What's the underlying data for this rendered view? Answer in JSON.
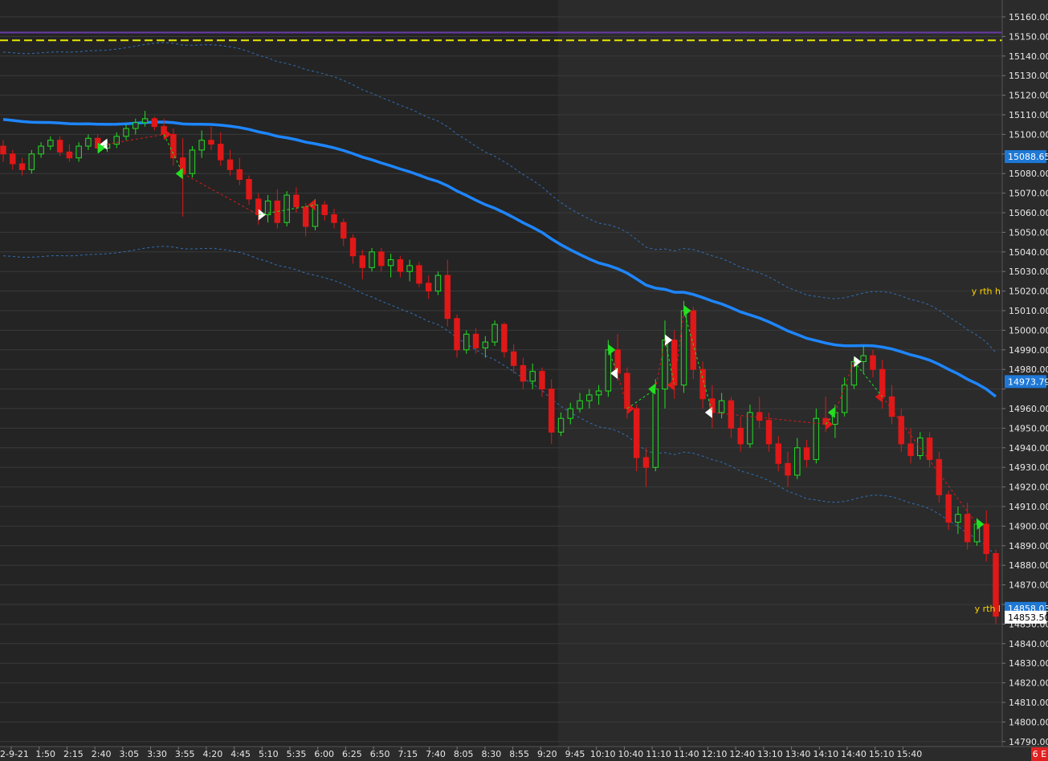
{
  "chart_data": {
    "type": "candlestick",
    "instrument_hint": "",
    "y_axis": {
      "ticks": [
        15160,
        15150,
        15140,
        15130,
        15120,
        15110,
        15100,
        15090,
        15080,
        15070,
        15060,
        15050,
        15040,
        15030,
        15020,
        15010,
        15000,
        14990,
        14980,
        14970,
        14960,
        14950,
        14940,
        14930,
        14920,
        14910,
        14900,
        14890,
        14880,
        14870,
        14860,
        14850,
        14840,
        14830,
        14820,
        14810,
        14800,
        14790
      ],
      "tick_labels": [
        "15160.00",
        "15150.00",
        "15140.00",
        "15130.00",
        "15120.00",
        "15110.00",
        "15100.00",
        "",
        "15080.00",
        "15070.00",
        "15060.00",
        "15050.00",
        "15040.00",
        "15030.00",
        "15020.00",
        "15010.00",
        "15000.00",
        "14990.00",
        "14980.00",
        "",
        "14960.00",
        "14950.00",
        "14940.00",
        "14930.00",
        "14920.00",
        "14910.00",
        "14900.00",
        "14890.00",
        "14880.00",
        "14870.00",
        "",
        "14850.00",
        "14840.00",
        "14830.00",
        "14820.00",
        "14810.00",
        "14800.00",
        "14790.00"
      ],
      "range": [
        14786,
        15165
      ],
      "side": "right"
    },
    "x_axis": {
      "tick_labels": [
        "2-9-21",
        "1:50",
        "2:15",
        "2:40",
        "3:05",
        "3:30",
        "3:55",
        "4:20",
        "4:45",
        "5:10",
        "5:35",
        "6:00",
        "6:25",
        "6:50",
        "7:15",
        "7:40",
        "8:05",
        "8:30",
        "8:55",
        "9:20",
        "9:45",
        "10:10",
        "10:40",
        "11:10",
        "11:40",
        "12:10",
        "12:40",
        "13:10",
        "13:40",
        "14:10",
        "14:40",
        "15:10",
        "15:40"
      ]
    },
    "price_tags": [
      {
        "label": "15088.65",
        "value": 15088.65,
        "color": "#1e78d6"
      },
      {
        "label": "14973.79",
        "value": 14973.79,
        "color": "#1e78d6"
      },
      {
        "label": "14858.03",
        "value": 14858.03,
        "color": "#1e78d6"
      },
      {
        "label": "14853.50",
        "value": 14853.5,
        "color": "#ffffff"
      }
    ],
    "level_labels": [
      {
        "label": "y rth h",
        "value": 15020
      },
      {
        "label": "y rth l",
        "value": 14858
      }
    ],
    "horizontal_levels": [
      {
        "value": 15152,
        "color": "#6a3aa8",
        "style": "solid"
      },
      {
        "value": 15148,
        "color": "#e6e600",
        "style": "dashed"
      }
    ],
    "corner_badge": {
      "label": "6 E",
      "color": "#e02020"
    },
    "candles_ohlc": [
      [
        15094,
        15097,
        15086,
        15090
      ],
      [
        15090,
        15092,
        15082,
        15085
      ],
      [
        15085,
        15088,
        15079,
        15082
      ],
      [
        15082,
        15092,
        15080,
        15090
      ],
      [
        15090,
        15096,
        15088,
        15094
      ],
      [
        15094,
        15099,
        15092,
        15097
      ],
      [
        15097,
        15099,
        15089,
        15091
      ],
      [
        15091,
        15095,
        15086,
        15088
      ],
      [
        15088,
        15096,
        15086,
        15094
      ],
      [
        15094,
        15100,
        15092,
        15098
      ],
      [
        15098,
        15100,
        15091,
        15093
      ],
      [
        15093,
        15097,
        15091,
        15095
      ],
      [
        15095,
        15101,
        15093,
        15099
      ],
      [
        15099,
        15105,
        15097,
        15103
      ],
      [
        15103,
        15108,
        15100,
        15106
      ],
      [
        15106,
        15112,
        15104,
        15108
      ],
      [
        15108,
        15109,
        15102,
        15104
      ],
      [
        15104,
        15108,
        15098,
        15100
      ],
      [
        15100,
        15103,
        15084,
        15088
      ],
      [
        15088,
        15098,
        15058,
        15080
      ],
      [
        15080,
        15094,
        15078,
        15092
      ],
      [
        15092,
        15102,
        15088,
        15097
      ],
      [
        15097,
        15104,
        15092,
        15095
      ],
      [
        15095,
        15101,
        15084,
        15087
      ],
      [
        15087,
        15092,
        15079,
        15082
      ],
      [
        15082,
        15088,
        15074,
        15077
      ],
      [
        15077,
        15079,
        15064,
        15067
      ],
      [
        15067,
        15070,
        15054,
        15059
      ],
      [
        15059,
        15069,
        15055,
        15066
      ],
      [
        15066,
        15072,
        15052,
        15055
      ],
      [
        15055,
        15071,
        15053,
        15069
      ],
      [
        15069,
        15073,
        15060,
        15063
      ],
      [
        15063,
        15065,
        15048,
        15053
      ],
      [
        15053,
        15067,
        15051,
        15064
      ],
      [
        15064,
        15066,
        15056,
        15059
      ],
      [
        15059,
        15062,
        15052,
        15055
      ],
      [
        15055,
        15057,
        15043,
        15047
      ],
      [
        15047,
        15049,
        15034,
        15038
      ],
      [
        15038,
        15041,
        15026,
        15032
      ],
      [
        15032,
        15042,
        15030,
        15040
      ],
      [
        15040,
        15042,
        15030,
        15033
      ],
      [
        15033,
        15039,
        15027,
        15036
      ],
      [
        15036,
        15038,
        15027,
        15030
      ],
      [
        15030,
        15036,
        15025,
        15033
      ],
      [
        15033,
        15035,
        15022,
        15024
      ],
      [
        15024,
        15028,
        15016,
        15020
      ],
      [
        15020,
        15030,
        15018,
        15028
      ],
      [
        15028,
        15036,
        15002,
        15006
      ],
      [
        15006,
        15008,
        14986,
        14990
      ],
      [
        14990,
        15000,
        14988,
        14998
      ],
      [
        14998,
        15001,
        14988,
        14991
      ],
      [
        14991,
        14997,
        14986,
        14994
      ],
      [
        14994,
        15005,
        14992,
        15003
      ],
      [
        15003,
        15004,
        14986,
        14989
      ],
      [
        14989,
        14993,
        14978,
        14982
      ],
      [
        14982,
        14986,
        14970,
        14974
      ],
      [
        14974,
        14983,
        14970,
        14979
      ],
      [
        14979,
        14981,
        14966,
        14970
      ],
      [
        14970,
        14975,
        14942,
        14948
      ],
      [
        14948,
        14958,
        14946,
        14955
      ],
      [
        14955,
        14963,
        14952,
        14960
      ],
      [
        14960,
        14968,
        14958,
        14964
      ],
      [
        14964,
        14970,
        14960,
        14967
      ],
      [
        14967,
        14972,
        14962,
        14969
      ],
      [
        14969,
        14995,
        14966,
        14990
      ],
      [
        14990,
        14998,
        14974,
        14978
      ],
      [
        14978,
        14981,
        14955,
        14960
      ],
      [
        14960,
        14962,
        14928,
        14935
      ],
      [
        14935,
        14940,
        14920,
        14930
      ],
      [
        14930,
        14975,
        14928,
        14970
      ],
      [
        14970,
        15005,
        14960,
        14995
      ],
      [
        14995,
        15000,
        14965,
        14972
      ],
      [
        14972,
        15015,
        14968,
        15010
      ],
      [
        15010,
        15012,
        14975,
        14980
      ],
      [
        14980,
        14984,
        14960,
        14965
      ],
      [
        14965,
        14972,
        14950,
        14958
      ],
      [
        14958,
        14968,
        14955,
        14964
      ],
      [
        14964,
        14966,
        14945,
        14950
      ],
      [
        14950,
        14956,
        14938,
        14942
      ],
      [
        14942,
        14962,
        14940,
        14958
      ],
      [
        14958,
        14966,
        14950,
        14954
      ],
      [
        14954,
        14958,
        14938,
        14942
      ],
      [
        14942,
        14946,
        14928,
        14932
      ],
      [
        14932,
        14938,
        14920,
        14926
      ],
      [
        14926,
        14945,
        14924,
        14940
      ],
      [
        14940,
        14944,
        14930,
        14934
      ],
      [
        14934,
        14960,
        14932,
        14955
      ],
      [
        14955,
        14966,
        14948,
        14952
      ],
      [
        14952,
        14962,
        14945,
        14958
      ],
      [
        14958,
        14976,
        14956,
        14972
      ],
      [
        14972,
        14986,
        14970,
        14984
      ],
      [
        14984,
        14992,
        14978,
        14987
      ],
      [
        14987,
        14990,
        14976,
        14980
      ],
      [
        14980,
        14985,
        14960,
        14966
      ],
      [
        14966,
        14972,
        14952,
        14956
      ],
      [
        14956,
        14960,
        14938,
        14942
      ],
      [
        14942,
        14950,
        14932,
        14936
      ],
      [
        14936,
        14948,
        14934,
        14945
      ],
      [
        14945,
        14948,
        14930,
        14934
      ],
      [
        14934,
        14938,
        14912,
        14916
      ],
      [
        14916,
        14918,
        14898,
        14902
      ],
      [
        14902,
        14910,
        14896,
        14906
      ],
      [
        14906,
        14912,
        14888,
        14892
      ],
      [
        14892,
        14904,
        14890,
        14901
      ],
      [
        14901,
        14908,
        14882,
        14886
      ],
      [
        14886,
        14888,
        14850,
        14854
      ]
    ]
  }
}
